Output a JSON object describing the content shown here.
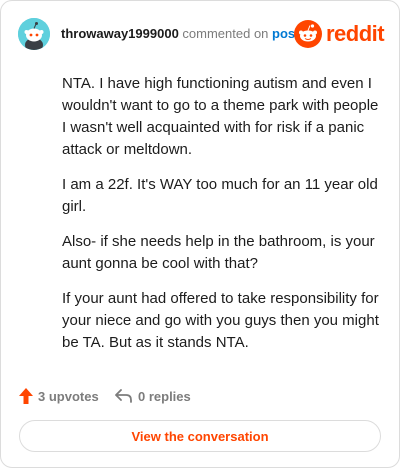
{
  "header": {
    "username": "throwaway1999000",
    "commented_text": "commented on",
    "post_link": "post",
    "logo_text": "reddit"
  },
  "comment": {
    "paragraphs": [
      "NTA. I have high functioning autism and even I wouldn't want to go to a theme park with people I wasn't well acquainted with for risk if a panic attack or meltdown.",
      "I am a 22f. It's WAY too much for an 11 year old girl.",
      "Also- if she needs help in the bathroom, is your aunt gonna be cool with that?",
      "If your aunt had offered to take responsibility for your niece and go with you guys then you might be TA. But as it stands NTA."
    ]
  },
  "actions": {
    "upvotes": "3 upvotes",
    "replies": "0 replies"
  },
  "footer": {
    "view_button": "View the conversation"
  },
  "colors": {
    "brand": "#ff4500",
    "link": "#0079d3",
    "avatar_bg": "#5fd0dd"
  }
}
